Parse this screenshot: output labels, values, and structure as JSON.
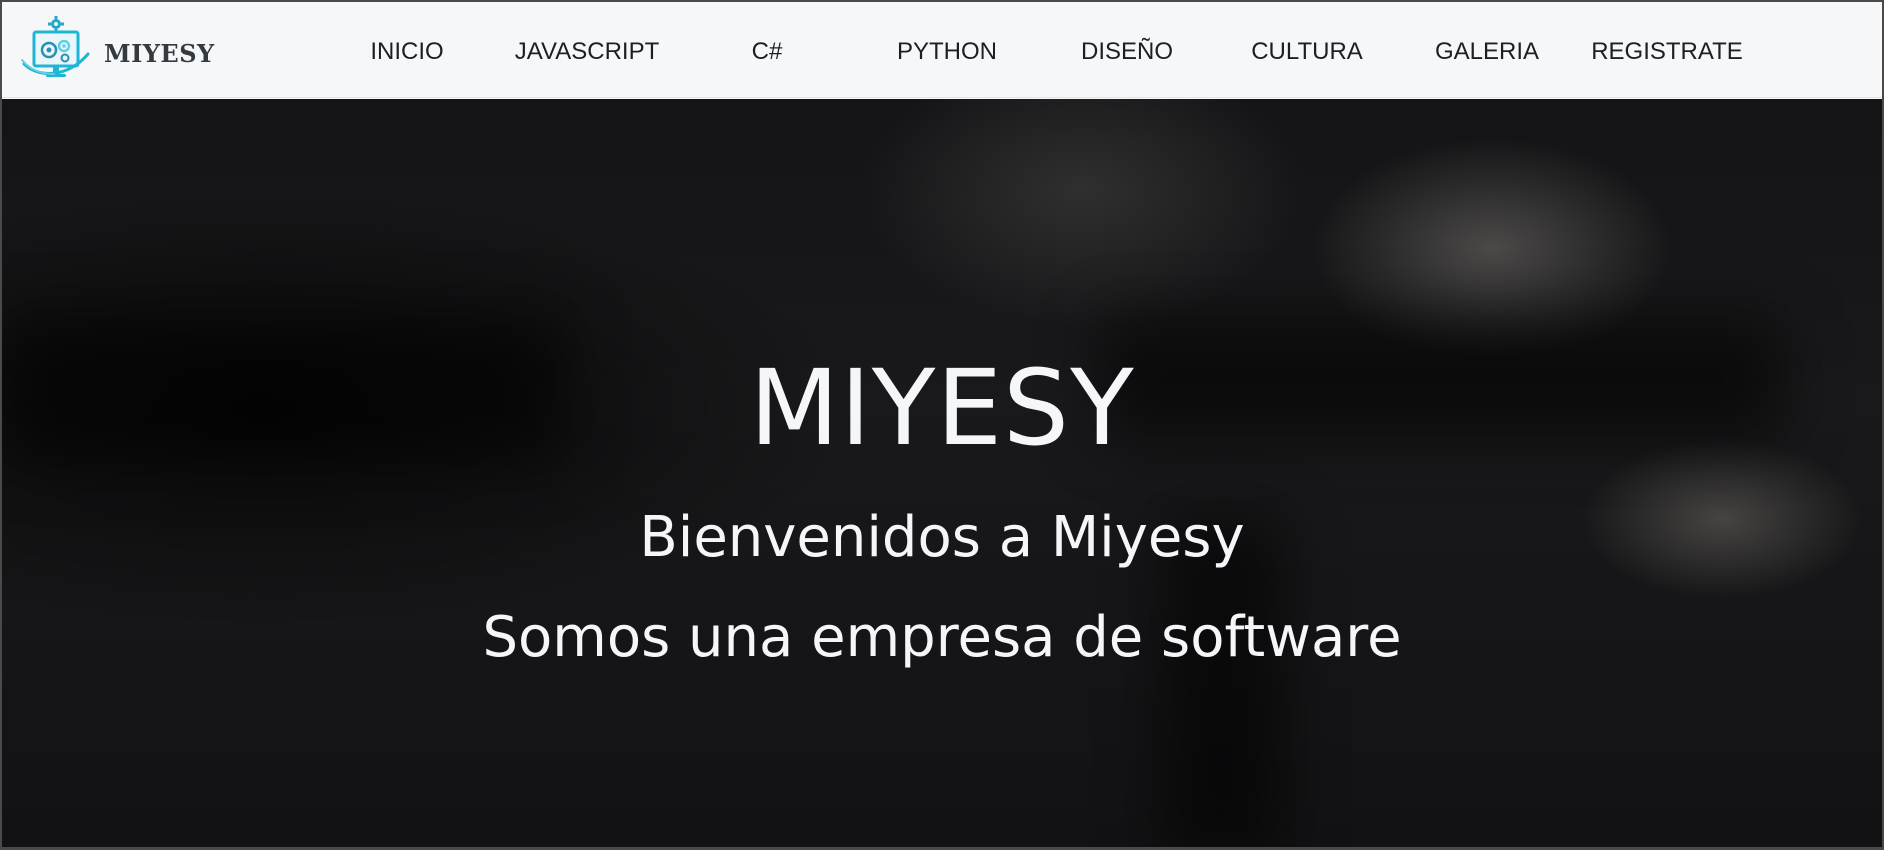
{
  "brand": {
    "name": "MIYESY",
    "logo_icon": "gears-monitor-logo-icon",
    "logo_colors": [
      "#1fb6d6",
      "#5fd0e6",
      "#2a8fb0"
    ]
  },
  "nav": {
    "items": [
      {
        "label": "INICIO"
      },
      {
        "label": "JAVASCRIPT"
      },
      {
        "label": "C#"
      },
      {
        "label": "PYTHON"
      },
      {
        "label": "DISEÑO"
      },
      {
        "label": "CULTURA"
      },
      {
        "label": "GALERIA"
      },
      {
        "label": "REGISTRATE"
      }
    ]
  },
  "hero": {
    "title": "MIYESY",
    "subtitle": "Bienvenidos a Miyesy",
    "tagline": "Somos una empresa de software"
  },
  "colors": {
    "navbar_bg": "#f6f7f9",
    "nav_text": "#1d1f22",
    "hero_bg": "#141416",
    "hero_text": "#f4f6fa"
  }
}
